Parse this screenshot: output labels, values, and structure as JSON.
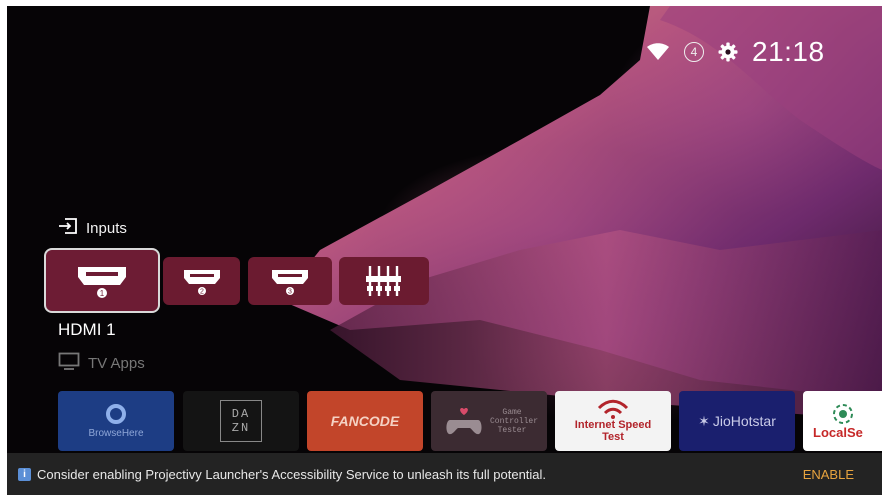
{
  "status_bar": {
    "notification_count": "4",
    "clock": "21:18",
    "icons": [
      "wifi-icon",
      "notification-icon",
      "gear-icon"
    ]
  },
  "inputs_section": {
    "title": "Inputs",
    "icon": "input-icon",
    "tiles": [
      {
        "name": "HDMI 1",
        "badge": "1",
        "icon": "hdmi-icon",
        "selected": true
      },
      {
        "name": "HDMI 2",
        "badge": "2",
        "icon": "hdmi-icon",
        "selected": false
      },
      {
        "name": "HDMI 3",
        "badge": "3",
        "icon": "hdmi-icon",
        "selected": false
      },
      {
        "name": "Component",
        "badge": "",
        "icon": "component-input-icon",
        "selected": false
      }
    ],
    "focused_label": "HDMI 1"
  },
  "apps_section": {
    "title": "TV Apps",
    "icon": "tv-icon",
    "apps": [
      {
        "label": "BrowseHere",
        "color": "#1e3f86"
      },
      {
        "label": "DA ZN",
        "color": "#141414"
      },
      {
        "label": "FANCODE",
        "color": "#c2452a"
      },
      {
        "label": "Game Controller Tester",
        "color": "#3c2b32"
      },
      {
        "label": "Internet Speed Test",
        "color": "#f4f4f4"
      },
      {
        "label": "JioHotstar",
        "color": "#1a1f6e"
      },
      {
        "label": "LocalSe",
        "color": "#ffffff"
      }
    ]
  },
  "banner": {
    "message": "Consider enabling Projectivy Launcher's Accessibility Service to unleash its full potential.",
    "action": "ENABLE",
    "icon": "info-icon"
  },
  "colors": {
    "tile": "#6b1b30",
    "accent_action": "#e7a33e",
    "banner_bg": "#232323"
  }
}
